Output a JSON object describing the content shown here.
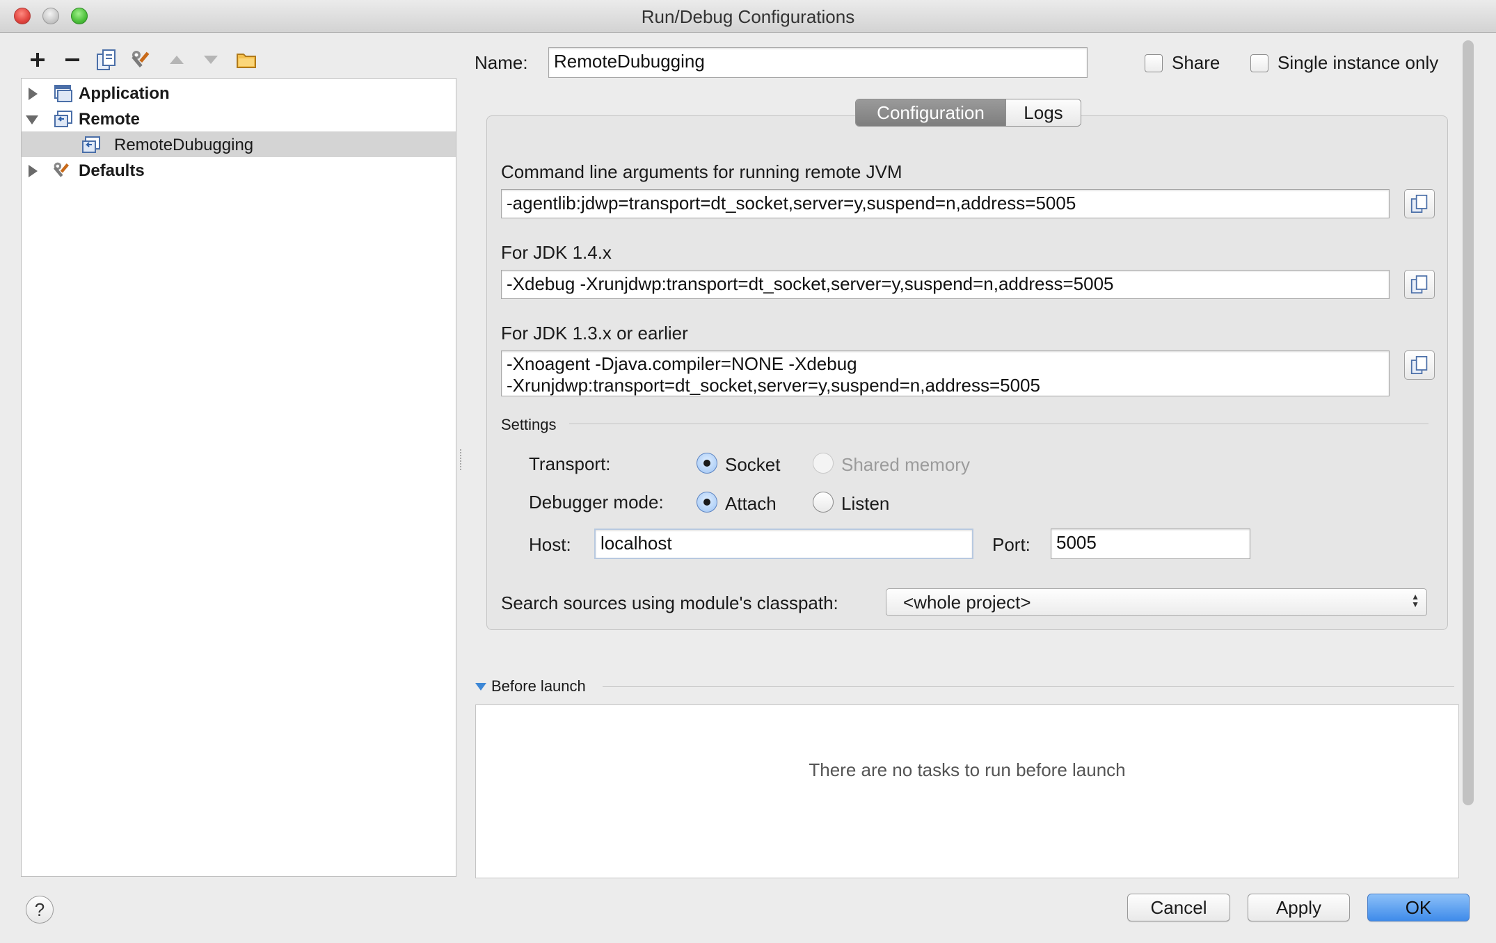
{
  "window": {
    "title": "Run/Debug Configurations"
  },
  "toolbar": {
    "items": [
      "add-icon",
      "remove-icon",
      "copy-icon",
      "wrench-icon",
      "move-up-icon",
      "move-down-icon",
      "folder-icon"
    ]
  },
  "tree": {
    "items": [
      {
        "label": "Application",
        "expanded": false,
        "bold": true
      },
      {
        "label": "Remote",
        "expanded": true,
        "bold": true
      },
      {
        "label": "RemoteDubugging",
        "selected": true,
        "bold": false
      },
      {
        "label": "Defaults",
        "expanded": false,
        "bold": true
      }
    ]
  },
  "name_row": {
    "label": "Name:",
    "value": "RemoteDubugging",
    "share_label": "Share",
    "share_checked": false,
    "single_instance_label": "Single instance only",
    "single_instance_checked": false
  },
  "tabs": [
    {
      "label": "Configuration",
      "active": true
    },
    {
      "label": "Logs",
      "active": false
    }
  ],
  "config": {
    "cmd_label": "Command line arguments for running remote JVM",
    "cmd_value": "-agentlib:jdwp=transport=dt_socket,server=y,suspend=n,address=5005",
    "jdk14_label": "For JDK 1.4.x",
    "jdk14_value": "-Xdebug -Xrunjdwp:transport=dt_socket,server=y,suspend=n,address=5005",
    "jdk13_label": "For JDK 1.3.x or earlier",
    "jdk13_line1": "-Xnoagent -Djava.compiler=NONE -Xdebug",
    "jdk13_line2": "-Xrunjdwp:transport=dt_socket,server=y,suspend=n,address=5005"
  },
  "settings": {
    "title": "Settings",
    "transport_label": "Transport:",
    "transport_socket": "Socket",
    "transport_shared": "Shared memory",
    "transport_selected": "Socket",
    "debugger_mode_label": "Debugger mode:",
    "mode_attach": "Attach",
    "mode_listen": "Listen",
    "mode_selected": "Attach",
    "host_label": "Host:",
    "host_value": "localhost",
    "port_label": "Port:",
    "port_value": "5005"
  },
  "search_sources": {
    "label": "Search sources using module's classpath:",
    "value": "<whole project>"
  },
  "before_launch": {
    "title": "Before launch",
    "empty_text": "There are no tasks to run before launch"
  },
  "buttons": {
    "help": "?",
    "cancel": "Cancel",
    "apply": "Apply",
    "ok": "OK"
  },
  "colors": {
    "window_bg": "#ececec",
    "primary_button": "#3f8bea",
    "active_tab": "#8a8a8a",
    "selected_row": "#d4d4d4"
  }
}
